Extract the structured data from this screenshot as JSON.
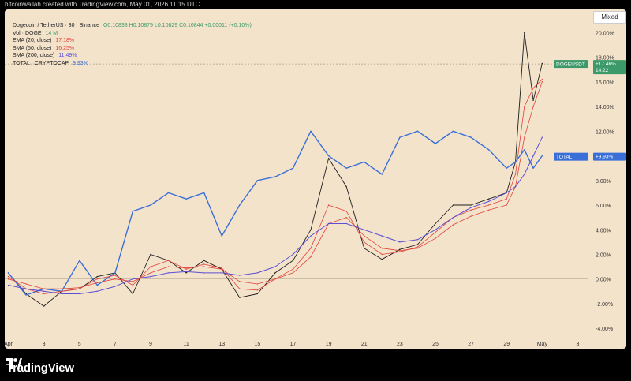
{
  "header": {
    "attribution": "bitcoinwallah created with TradingView.com, May 01, 2026 11:15 UTC"
  },
  "toolbar": {
    "mode_label": "Mixed"
  },
  "legend": {
    "symbol_line": "Dogecoin / TetherUS · 30 · Binance",
    "ohlc": "O0.10833 H0.10879 L0.10829 C0.10844 +0.00011 (+0.10%)",
    "vol_label": "Vol · DOGE",
    "vol_value": "14 M",
    "ema_label": "EMA (20, close)",
    "ema_value": "17.18%",
    "sma50_label": "SMA (50, close)",
    "sma50_value": "16.25%",
    "sma200_label": "SMA (200, close)",
    "sma200_value": "11.49%",
    "total_label": "TOTAL · CRYPTOCAP",
    "total_value": "9.93%"
  },
  "badges": {
    "doge_symbol": "DOGEUSDT",
    "doge_value": "+17.46%",
    "doge_timer": "14:22",
    "total_symbol": "TOTAL",
    "total_value": "+9.93%"
  },
  "footer": {
    "brand": "TradingView"
  },
  "colors": {
    "background": "#f4e3cb",
    "doge": "#1e1e1e",
    "total": "#3a6fd8",
    "ema": "#e0443c",
    "sma50": "#e0443c",
    "sma200": "#5b4fd6",
    "badge_green": "#3c9a6a"
  },
  "chart_data": {
    "type": "line",
    "title": "",
    "xlabel": "",
    "ylabel": "",
    "y_unit": "%",
    "ylim": [
      -4.5,
      21.5
    ],
    "y_ticks": [
      "20.00%",
      "18.00%",
      "16.00%",
      "14.00%",
      "12.00%",
      "10.00%",
      "8.00%",
      "6.00%",
      "4.00%",
      "2.00%",
      "0.00%",
      "-2.00%",
      "-4.00%"
    ],
    "x_ticks": [
      "Apr",
      "3",
      "5",
      "7",
      "9",
      "11",
      "13",
      "15",
      "17",
      "19",
      "21",
      "23",
      "25",
      "27",
      "29",
      "May",
      "3"
    ],
    "x": [
      1,
      2,
      3,
      4,
      5,
      6,
      7,
      8,
      9,
      10,
      11,
      12,
      13,
      14,
      15,
      16,
      17,
      18,
      19,
      20,
      21,
      22,
      23,
      24,
      25,
      26,
      27,
      28,
      29,
      29.5,
      30,
      30.5,
      31
    ],
    "series": [
      {
        "name": "DOGEUSDT",
        "values": [
          0.5,
          -1.2,
          -2.2,
          -1.0,
          -0.8,
          0.2,
          0.5,
          -1.2,
          2.0,
          1.5,
          0.5,
          1.5,
          0.8,
          -1.5,
          -1.2,
          0.5,
          1.5,
          4.0,
          9.8,
          7.5,
          2.5,
          1.6,
          2.4,
          2.8,
          4.5,
          6.0,
          6.0,
          6.5,
          7.0,
          9.5,
          20.0,
          14.5,
          17.5
        ]
      },
      {
        "name": "TOTAL",
        "values": [
          0.5,
          -1.3,
          -0.8,
          -1.0,
          1.5,
          -0.5,
          0.5,
          5.5,
          6.0,
          7.0,
          6.5,
          7.0,
          3.5,
          6.0,
          8.0,
          8.3,
          9.0,
          12.0,
          10.0,
          9.0,
          9.5,
          8.5,
          11.5,
          12.0,
          11.0,
          12.0,
          11.5,
          10.5,
          9.0,
          9.5,
          10.5,
          9.0,
          10.0
        ]
      },
      {
        "name": "EMA (20, close)",
        "values": [
          0.2,
          -0.8,
          -1.2,
          -1.0,
          -0.8,
          0.0,
          0.3,
          -0.5,
          1.0,
          1.5,
          0.8,
          1.2,
          0.9,
          -0.8,
          -0.9,
          0.0,
          0.8,
          2.5,
          6.0,
          5.5,
          3.0,
          2.0,
          2.2,
          2.6,
          3.8,
          5.0,
          5.6,
          6.0,
          6.5,
          8.5,
          14.0,
          15.5,
          16.2
        ]
      },
      {
        "name": "SMA (50, close)",
        "values": [
          0.0,
          -0.4,
          -0.8,
          -0.8,
          -0.7,
          -0.3,
          0.0,
          -0.2,
          0.5,
          1.0,
          0.9,
          1.0,
          0.8,
          -0.2,
          -0.4,
          0.0,
          0.5,
          1.8,
          4.5,
          5.0,
          3.5,
          2.5,
          2.3,
          2.5,
          3.3,
          4.4,
          5.1,
          5.6,
          6.0,
          7.5,
          11.5,
          14.0,
          16.0
        ]
      },
      {
        "name": "SMA (200, close)",
        "values": [
          -0.5,
          -0.8,
          -1.0,
          -1.2,
          -1.2,
          -1.0,
          -0.6,
          0.0,
          0.2,
          0.5,
          0.6,
          0.5,
          0.5,
          0.3,
          0.5,
          1.0,
          2.0,
          3.5,
          4.5,
          4.5,
          4.0,
          3.5,
          3.0,
          3.2,
          4.0,
          5.0,
          5.8,
          6.3,
          7.0,
          7.5,
          8.5,
          10.0,
          11.5
        ]
      }
    ]
  }
}
